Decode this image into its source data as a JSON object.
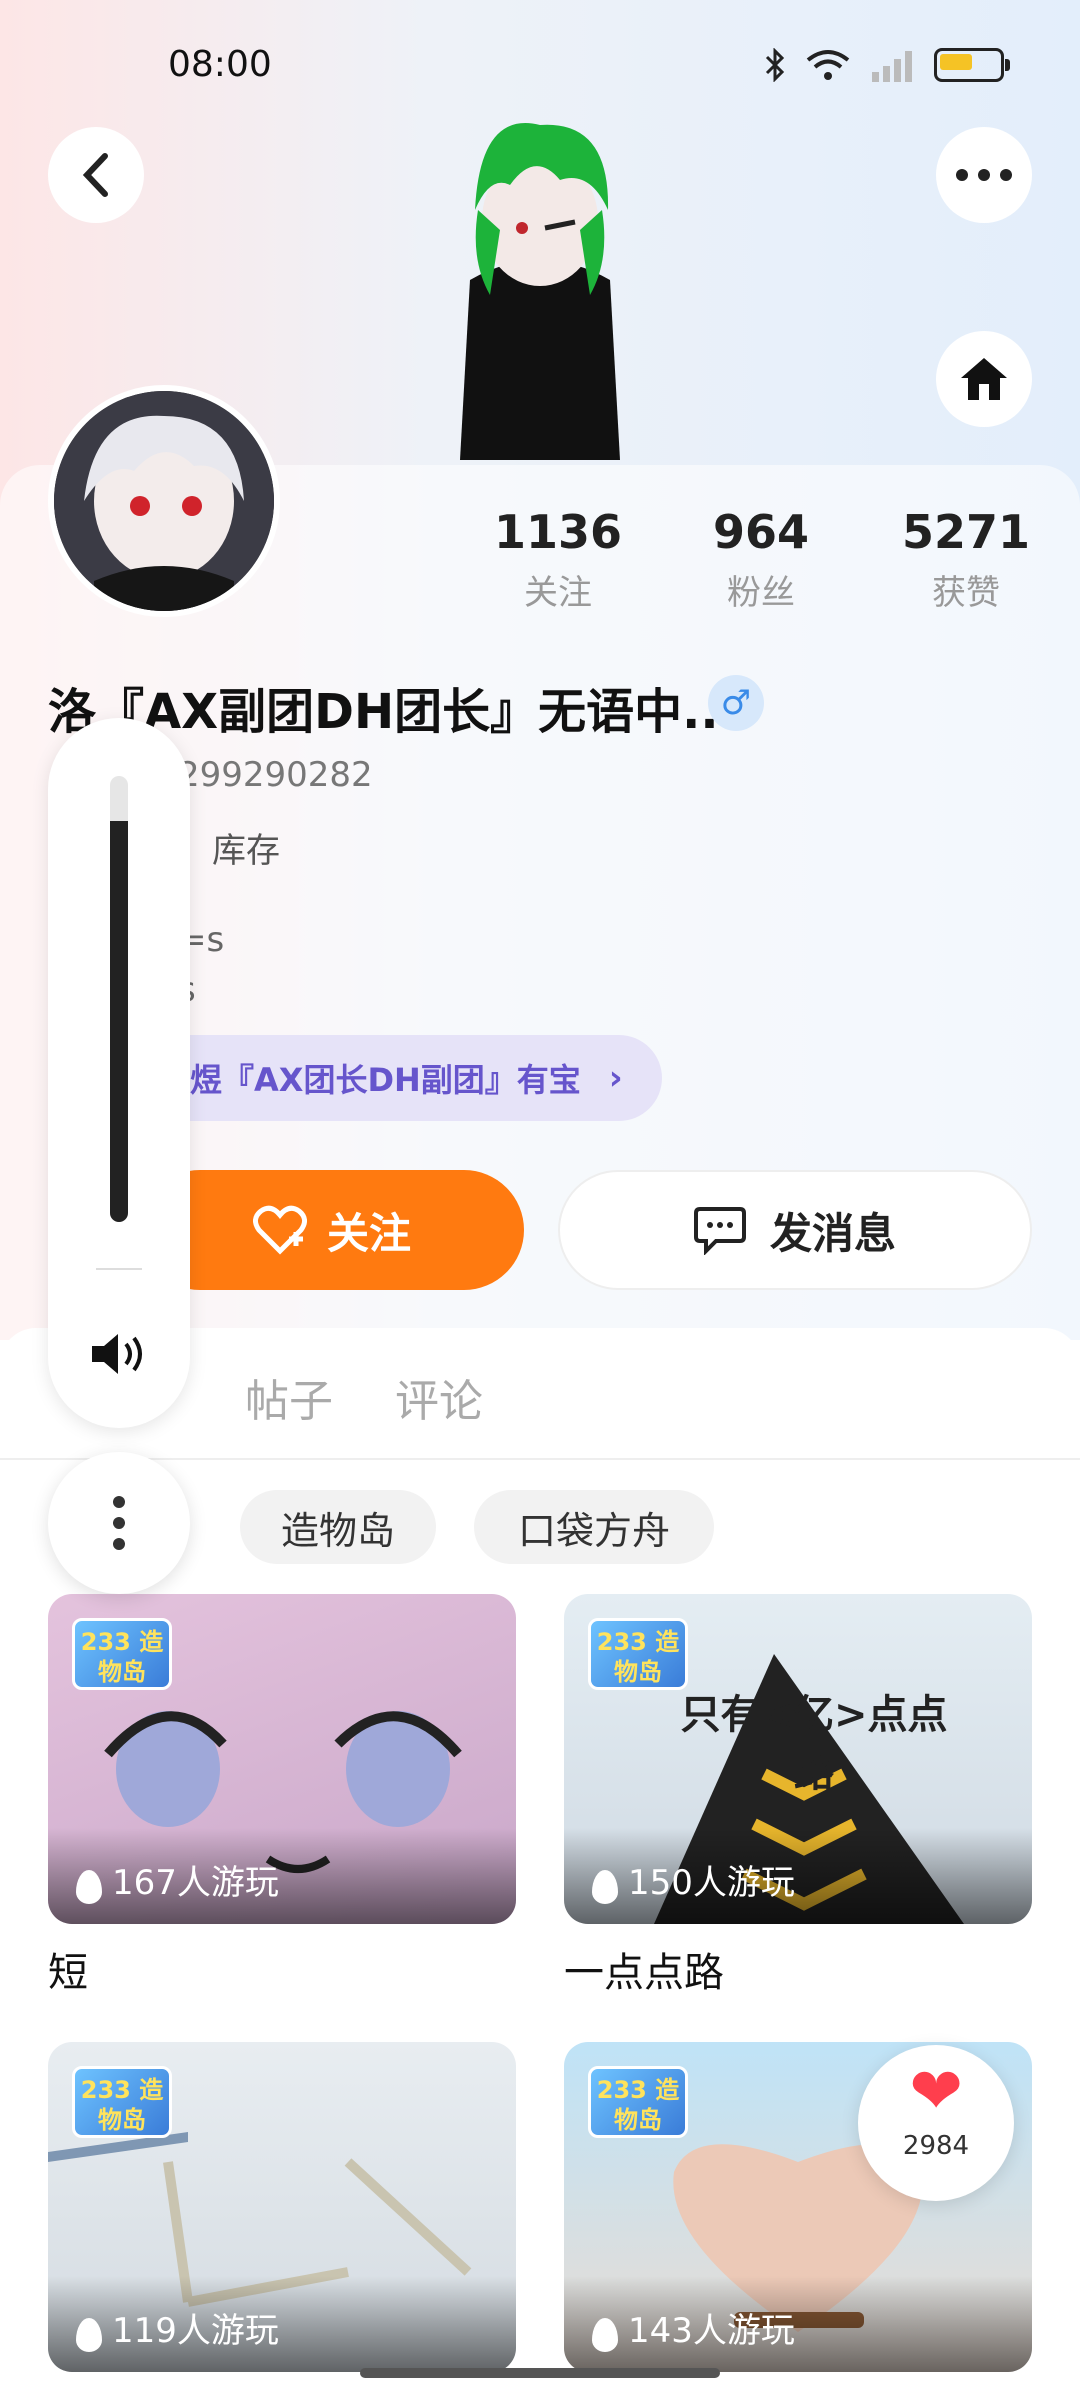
{
  "status_bar": {
    "time": "08:00"
  },
  "profile": {
    "nickname": "洛『AX副团DH团长』无语中...",
    "gender_symbol": "♂",
    "uid": "299290282",
    "signature_line1": "、库存",
    "signature_line2": "=s",
    "signature_line3": "s",
    "group_link": "煜『AX团长DH副团』有宝",
    "stats": [
      {
        "value": "1136",
        "label": "关注"
      },
      {
        "value": "964",
        "label": "粉丝"
      },
      {
        "value": "5271",
        "label": "获赞"
      }
    ]
  },
  "actions": {
    "follow": "关注",
    "message": "发消息"
  },
  "tabs": [
    "帖子",
    "评论"
  ],
  "filters": [
    "造物岛",
    "口袋方舟"
  ],
  "games": [
    {
      "badge": "233 造物岛",
      "players": "167人游玩",
      "title": "短"
    },
    {
      "badge": "233 造物岛",
      "players": "150人游玩",
      "title": "一点点路",
      "overlay_text": "只有<亿>点点路"
    },
    {
      "badge": "233 造物岛",
      "players": "119人游玩",
      "title": ""
    },
    {
      "badge": "233 造物岛",
      "players": "143人游玩",
      "title": ""
    }
  ],
  "floating": {
    "like_count": "2984"
  },
  "volume": {
    "level": 0.9
  },
  "colors": {
    "accent": "#ff7a10",
    "group_link_text": "#6655cc"
  }
}
